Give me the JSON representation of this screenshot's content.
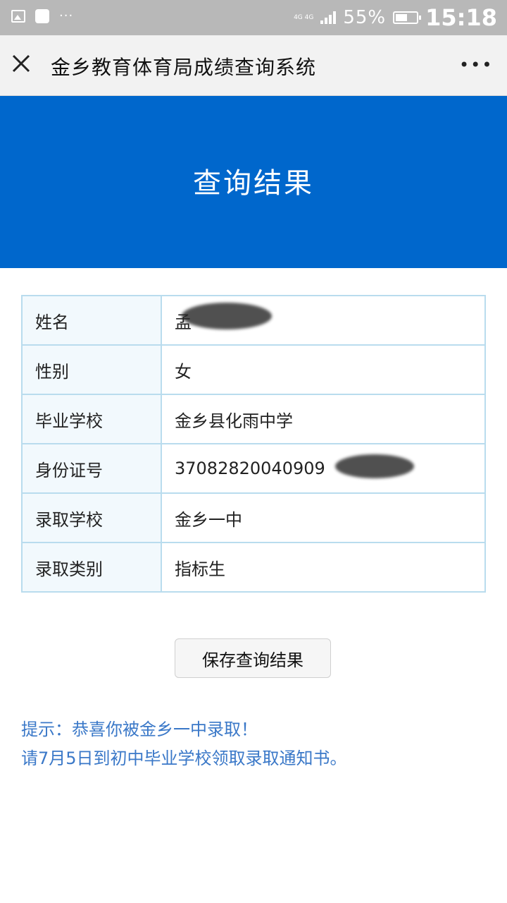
{
  "status_bar": {
    "network": "4G 4G",
    "battery_percent": "55%",
    "time": "15:18"
  },
  "header": {
    "title": "金乡教育体育局成绩查询系统",
    "more_label": "•••"
  },
  "banner": {
    "title": "查询结果"
  },
  "result_table": {
    "rows": [
      {
        "label": "姓名",
        "value": "孟"
      },
      {
        "label": "性别",
        "value": "女"
      },
      {
        "label": "毕业学校",
        "value": "金乡县化雨中学"
      },
      {
        "label": "身份证号",
        "value": "37082820040909"
      },
      {
        "label": "录取学校",
        "value": "金乡一中"
      },
      {
        "label": "录取类别",
        "value": "指标生"
      }
    ]
  },
  "save_button": {
    "label": "保存查询结果"
  },
  "notice": {
    "line1": "提示：恭喜你被金乡一中录取！",
    "line2": "请7月5日到初中毕业学校领取录取通知书。"
  },
  "colors": {
    "banner_bg": "#0067cc",
    "table_border": "#b9dcee",
    "notice_text": "#3a78c8"
  }
}
